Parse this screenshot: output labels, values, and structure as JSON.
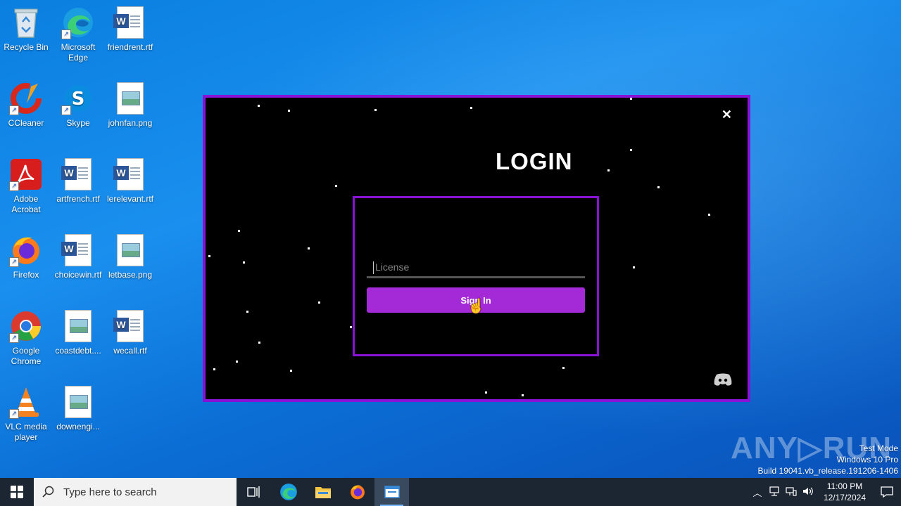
{
  "desktop": {
    "icons": [
      {
        "label": "Recycle Bin",
        "type": "recycle"
      },
      {
        "label": "Microsoft Edge",
        "type": "edge"
      },
      {
        "label": "friendrent.rtf",
        "type": "word"
      },
      {
        "label": "CCleaner",
        "type": "ccleaner"
      },
      {
        "label": "Skype",
        "type": "skype"
      },
      {
        "label": "johnfan.png",
        "type": "image"
      },
      {
        "label": "Adobe Acrobat",
        "type": "acrobat"
      },
      {
        "label": "artfrench.rtf",
        "type": "word"
      },
      {
        "label": "lerelevant.rtf",
        "type": "word"
      },
      {
        "label": "Firefox",
        "type": "firefox"
      },
      {
        "label": "choicewin.rtf",
        "type": "word"
      },
      {
        "label": "letbase.png",
        "type": "image"
      },
      {
        "label": "Google Chrome",
        "type": "chrome"
      },
      {
        "label": "coastdebt....",
        "type": "image"
      },
      {
        "label": "wecall.rtf",
        "type": "word"
      },
      {
        "label": "VLC media player",
        "type": "vlc"
      },
      {
        "label": "downengi...",
        "type": "image"
      }
    ]
  },
  "login": {
    "title": "LOGIN",
    "close_label": "✕",
    "license_placeholder": "License",
    "license_value": "",
    "signin_label": "Sign In",
    "accent": "#8a12d6",
    "button_color": "#a42ad8"
  },
  "watermark": {
    "text": "ANY▷RUN",
    "mode": "Test Mode",
    "os": "Windows 10 Pro",
    "build": "Build 19041.vb_release.191206-1406"
  },
  "taskbar": {
    "search_placeholder": "Type here to search",
    "time": "11:00 PM",
    "date": "12/17/2024"
  }
}
